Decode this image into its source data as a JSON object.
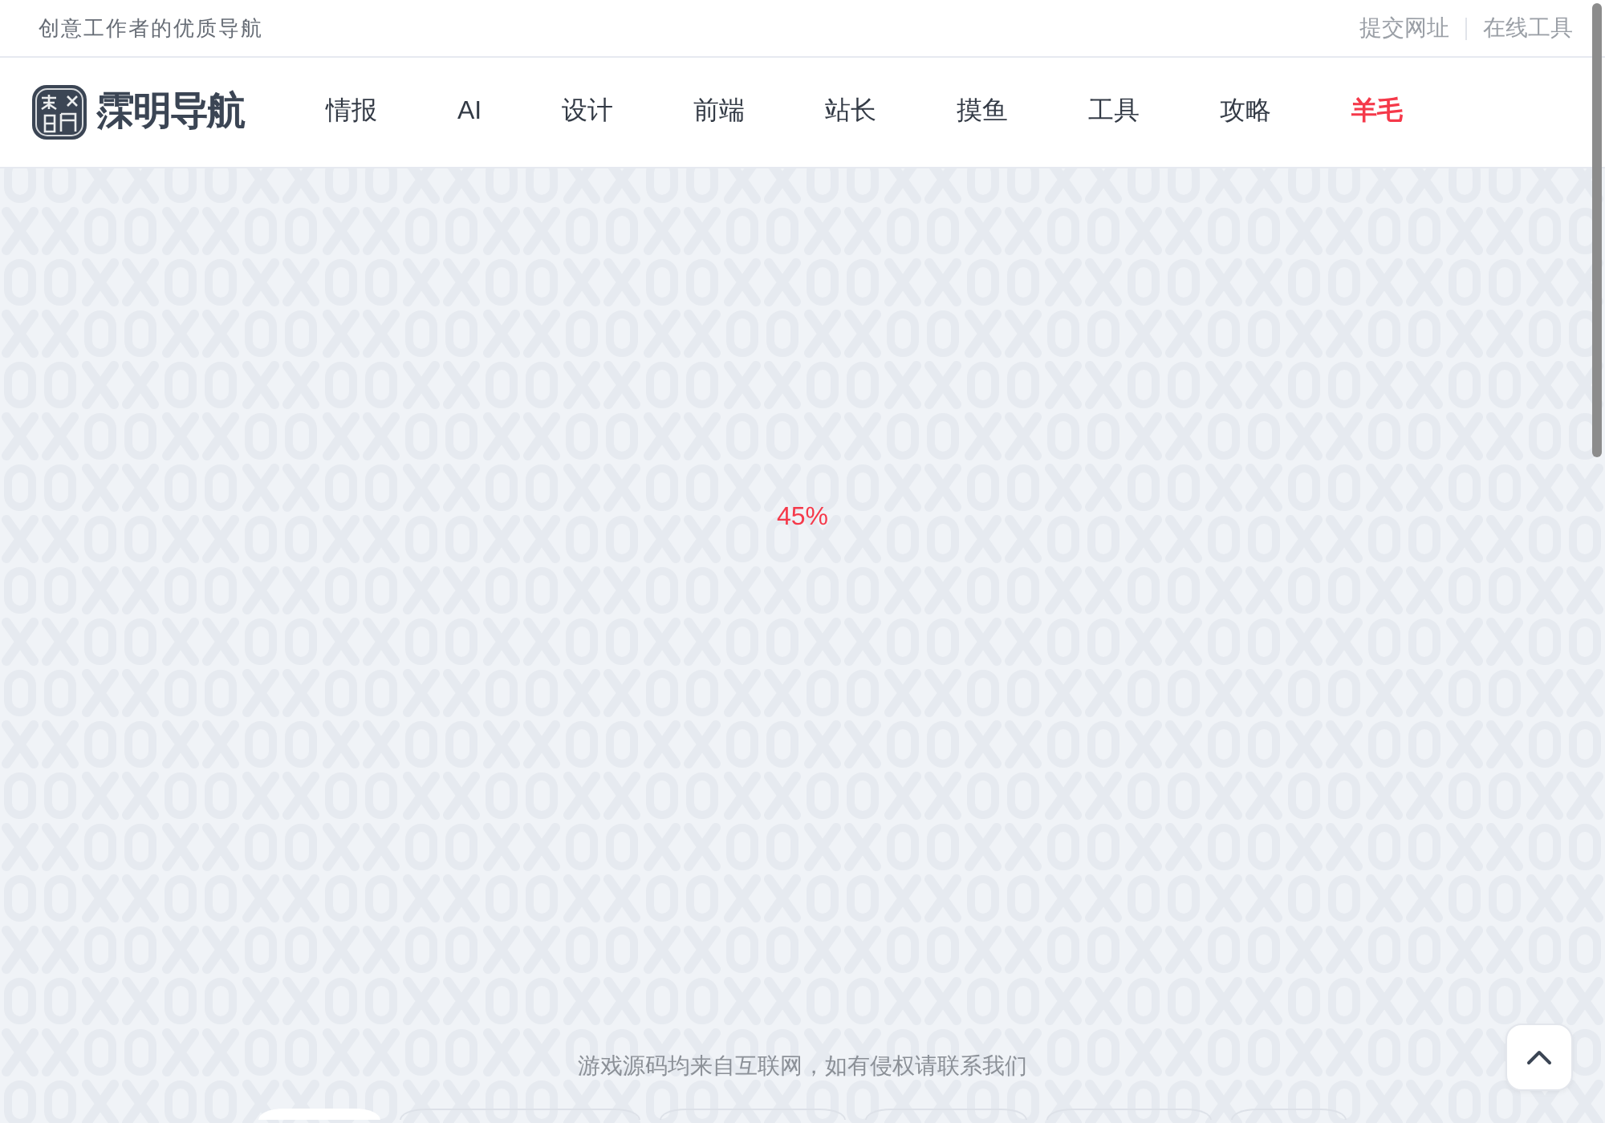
{
  "top_bar": {
    "tagline": "创意工作者的优质导航",
    "links": [
      "提交网址",
      "在线工具"
    ]
  },
  "navbar": {
    "logo_text": "霂明导航",
    "items": [
      {
        "label": "情报",
        "highlighted": false
      },
      {
        "label": "AI",
        "highlighted": false
      },
      {
        "label": "设计",
        "highlighted": false
      },
      {
        "label": "前端",
        "highlighted": false
      },
      {
        "label": "站长",
        "highlighted": false
      },
      {
        "label": "摸鱼",
        "highlighted": false
      },
      {
        "label": "工具",
        "highlighted": false
      },
      {
        "label": "攻略",
        "highlighted": false
      },
      {
        "label": "羊毛",
        "highlighted": true
      }
    ]
  },
  "loader": {
    "percent": "45%"
  },
  "footer": {
    "notice": "游戏源码均来自互联网，如有侵权请联系我们"
  },
  "category_tabs": [
    {
      "selected": true
    },
    {
      "selected": false
    },
    {
      "selected": false
    },
    {
      "selected": false
    },
    {
      "selected": false
    },
    {
      "selected": false
    }
  ]
}
